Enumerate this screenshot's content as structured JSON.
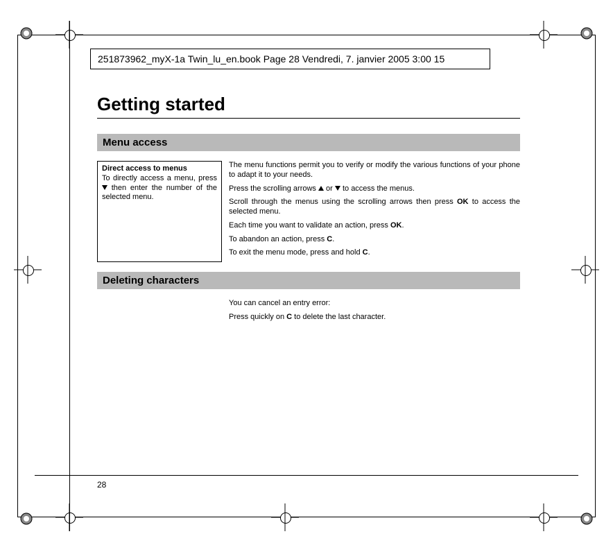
{
  "header": {
    "text": "251873962_myX-1a Twin_lu_en.book  Page 28  Vendredi, 7. janvier 2005  3:00 15"
  },
  "title": "Getting started",
  "sections": {
    "menu_access": {
      "heading": "Menu access",
      "aside_title": "Direct access to menus",
      "aside_body_1": "To directly access a menu, press ",
      "aside_body_2": " then enter the number of the selected menu.",
      "p1": "The menu functions permit you to verify or modify the various functions of your phone to adapt it to your needs.",
      "p2a": "Press the scrolling arrows ",
      "p2b": " or ",
      "p2c": " to access the menus.",
      "p3a": "Scroll through the menus using the scrolling arrows then press ",
      "p3b": "OK",
      "p3c": " to access the selected menu.",
      "p4a": "Each time you want to validate an action, press ",
      "p4b": "OK",
      "p4c": ".",
      "p5a": "To abandon an action, press ",
      "p5b": "C",
      "p5c": ".",
      "p6a": "To exit the menu mode, press and hold ",
      "p6b": "C",
      "p6c": "."
    },
    "deleting": {
      "heading": "Deleting characters",
      "p1": "You can cancel an entry error:",
      "p2a": "Press quickly on ",
      "p2b": "C",
      "p2c": " to delete the last character."
    }
  },
  "page_number": "28"
}
